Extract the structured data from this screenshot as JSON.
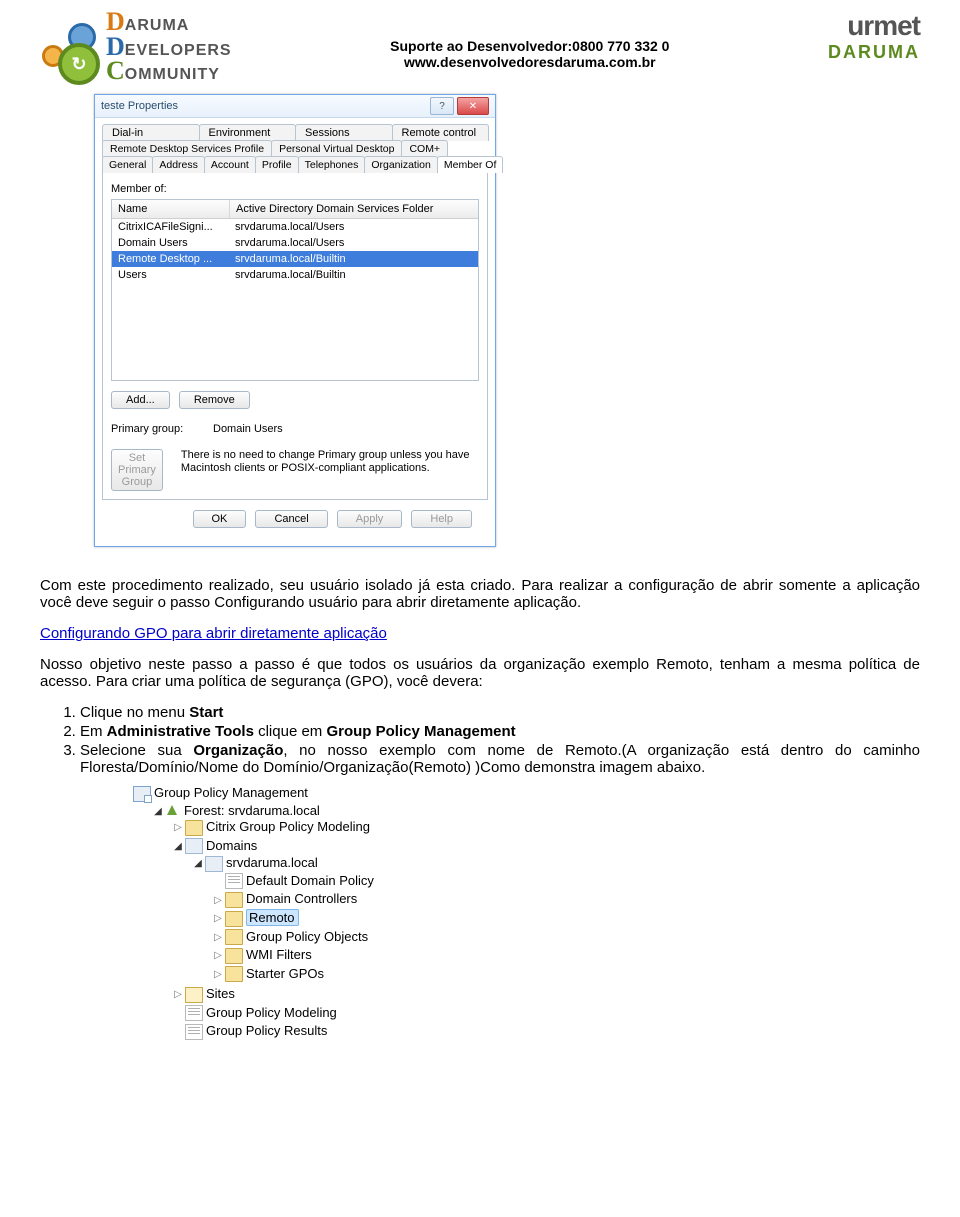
{
  "header": {
    "logo_left": {
      "l1_big": "D",
      "l1_rest": "ARUMA",
      "l2_big": "D",
      "l2_rest": "EVELOPERS",
      "l3_big": "C",
      "l3_rest": "OMMUNITY"
    },
    "center_line1_bold": "Suporte ao Desenvolvedor:",
    "center_line1_num": "0800 770 332 0",
    "center_line2": "www.desenvolvedoresdaruma.com.br",
    "logo_right": {
      "line1": "urmet",
      "line2": "DARUMA"
    }
  },
  "dialog": {
    "title": "teste Properties",
    "help_icon": "?",
    "close_icon": "✕",
    "tabs_row1": [
      "Dial-in",
      "Environment",
      "Sessions",
      "Remote control"
    ],
    "tabs_row2": [
      "Remote Desktop Services Profile",
      "Personal Virtual Desktop",
      "COM+"
    ],
    "tabs_row3": [
      "General",
      "Address",
      "Account",
      "Profile",
      "Telephones",
      "Organization",
      "Member Of"
    ],
    "active_tab": "Member Of",
    "member_of_label": "Member of:",
    "headers": {
      "name": "Name",
      "path": "Active Directory Domain Services Folder"
    },
    "rows": [
      {
        "name": "CitrixICAFileSigni...",
        "path": "srvdaruma.local/Users",
        "selected": false
      },
      {
        "name": "Domain Users",
        "path": "srvdaruma.local/Users",
        "selected": false
      },
      {
        "name": "Remote Desktop ...",
        "path": "srvdaruma.local/Builtin",
        "selected": true
      },
      {
        "name": "Users",
        "path": "srvdaruma.local/Builtin",
        "selected": false
      }
    ],
    "add_btn": "Add...",
    "remove_btn": "Remove",
    "primary_label": "Primary group:",
    "primary_value": "Domain Users",
    "set_primary_btn": "Set Primary Group",
    "note": "There is no need to change Primary group unless you have Macintosh clients or POSIX-compliant applications.",
    "ok": "OK",
    "cancel": "Cancel",
    "apply": "Apply",
    "help": "Help"
  },
  "text": {
    "p1": "Com este procedimento realizado, seu usuário isolado já esta criado. Para realizar a configuração de abrir somente a aplicação você deve seguir o passo Configurando usuário para abrir diretamente aplicação.",
    "h2": "Configurando GPO para abrir diretamente aplicação",
    "p2": "Nosso objetivo neste passo a passo é que todos os usuários da organização exemplo Remoto, tenham a mesma política de acesso. Para criar uma política de segurança (GPO), você devera:",
    "li1_a": "Clique no menu ",
    "li1_b": "Start",
    "li2_a": "Em ",
    "li2_b": "Administrative Tools",
    "li2_c": " clique em ",
    "li2_d": "Group Policy Management",
    "li3_a": "Selecione sua ",
    "li3_b": "Organização",
    "li3_c": ", no nosso exemplo com nome de Remoto.(A organização está dentro do caminho Floresta/Domínio/Nome do Domínio/Organização(Remoto) )Como demonstra imagem abaixo."
  },
  "tree": {
    "root": "Group Policy Management",
    "forest": "Forest: srvdaruma.local",
    "citrix": "Citrix Group Policy Modeling",
    "domains": "Domains",
    "domain": "srvdaruma.local",
    "items": [
      {
        "label": "Default Domain Policy",
        "icon": "policy",
        "tw": ""
      },
      {
        "label": "Domain Controllers",
        "icon": "folder",
        "tw": "▷"
      },
      {
        "label": "Remoto",
        "icon": "folder",
        "tw": "▷",
        "selected": true
      },
      {
        "label": "Group Policy Objects",
        "icon": "folder",
        "tw": "▷"
      },
      {
        "label": "WMI Filters",
        "icon": "folder",
        "tw": "▷"
      },
      {
        "label": "Starter GPOs",
        "icon": "folder",
        "tw": "▷"
      }
    ],
    "sites": "Sites",
    "gpm_model": "Group Policy Modeling",
    "gpm_results": "Group Policy Results"
  }
}
